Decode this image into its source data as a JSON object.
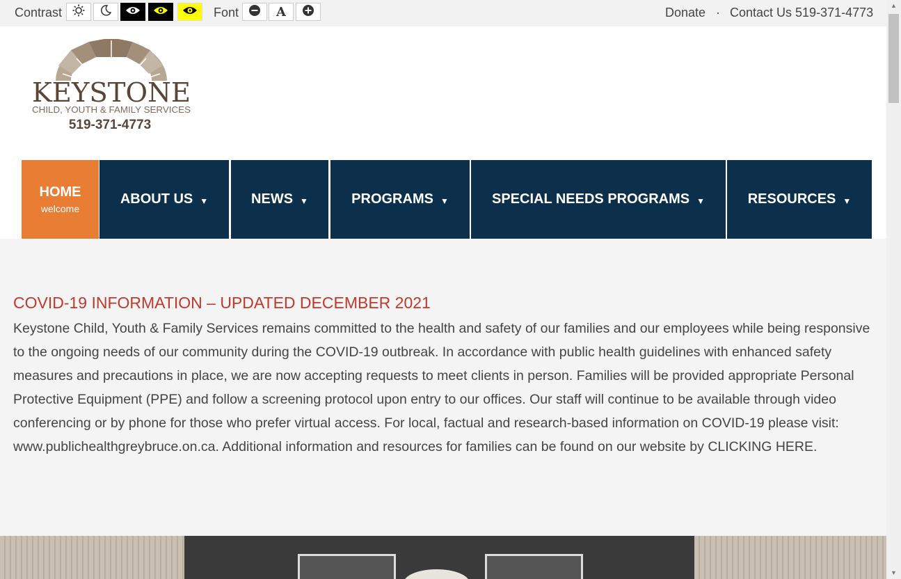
{
  "topbar": {
    "contrast_label": "Contrast",
    "font_label": "Font",
    "contrast_buttons": [
      {
        "name": "sun-icon",
        "theme": "light"
      },
      {
        "name": "moon-icon",
        "theme": "dark-mode"
      },
      {
        "name": "eye-icon",
        "theme": "black-white"
      },
      {
        "name": "eye-icon",
        "theme": "black-yellow"
      },
      {
        "name": "eye-icon",
        "theme": "yellow-black"
      }
    ],
    "font_buttons": [
      {
        "name": "minus-icon",
        "action": "decrease"
      },
      {
        "name": "font-a-icon",
        "label": "A",
        "action": "reset"
      },
      {
        "name": "plus-icon",
        "action": "increase"
      }
    ],
    "donate_label": "Donate",
    "separator": "·",
    "contact_label": "Contact Us 519-371-4773"
  },
  "logo": {
    "name": "KEYSTONE",
    "tagline": "CHILD, YOUTH & FAMILY SERVICES",
    "phone": "519-371-4773"
  },
  "nav": {
    "home": {
      "label": "HOME",
      "sub": "welcome"
    },
    "items": [
      {
        "label": "ABOUT US",
        "caret": "▼"
      },
      {
        "label": "NEWS",
        "caret": "▼"
      },
      {
        "label": "PROGRAMS",
        "caret": "▼"
      },
      {
        "label": "SPECIAL NEEDS PROGRAMS",
        "caret": "▼"
      },
      {
        "label": "RESOURCES",
        "caret": "▼"
      }
    ]
  },
  "main": {
    "title": "COVID-19 INFORMATION – UPDATED DECEMBER 2021",
    "body": "Keystone Child, Youth & Family Services remains committed to the health and safety of our families and our employees while being responsive to the ongoing needs of our community during the COVID-19 outbreak. In accordance with public health guidelines with enhanced safety measures and precautions in place, we are now accepting requests to meet clients in person. Families will be provided appropriate Personal Protective Equipment (PPE) and follow a screening protocol upon entry to our offices. Our staff will continue to be available through video conferencing or by phone for those who prefer virtual access. For local, factual and research-based information on COVID-19 please visit: www.publichealthgreybruce.on.ca. Additional information and resources for families can be found on our website by CLICKING HERE."
  },
  "colors": {
    "nav_bg": "#0c2f4c",
    "home_bg": "#e97d34",
    "title_color": "#c0392b",
    "logo_brown": "#5a4637"
  }
}
